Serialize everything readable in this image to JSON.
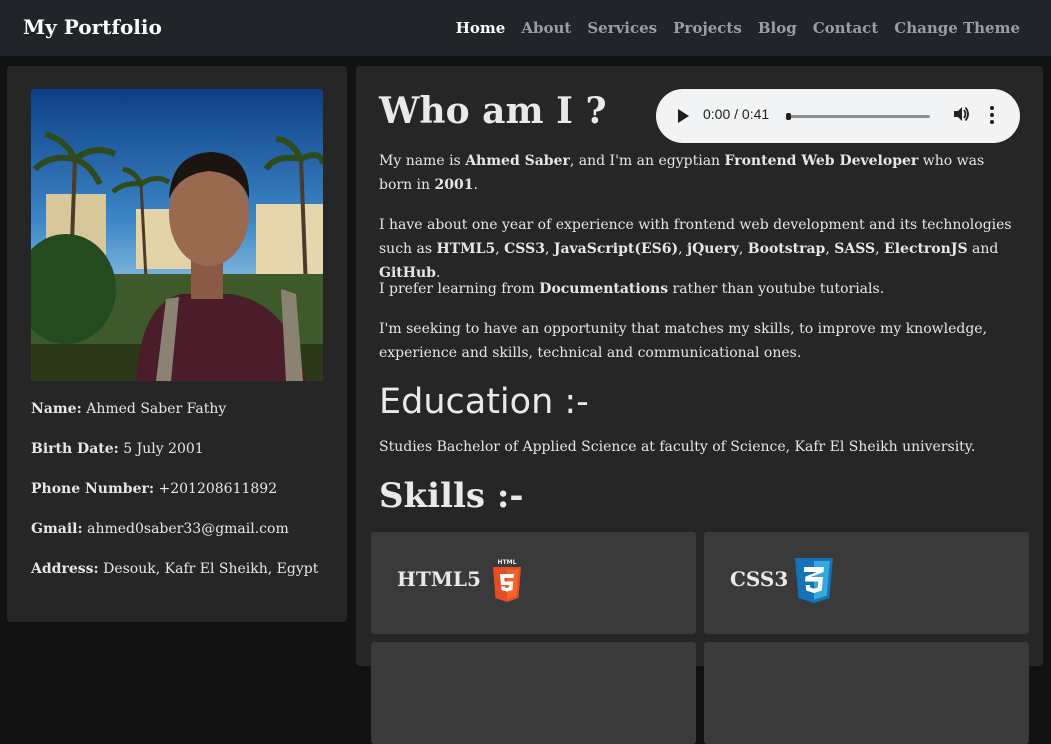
{
  "nav": {
    "brand": "My Portfolio",
    "links": [
      {
        "label": "Home",
        "active": true
      },
      {
        "label": "About",
        "active": false
      },
      {
        "label": "Services",
        "active": false
      },
      {
        "label": "Projects",
        "active": false
      },
      {
        "label": "Blog",
        "active": false
      },
      {
        "label": "Contact",
        "active": false
      },
      {
        "label": "Change Theme",
        "active": false
      }
    ]
  },
  "profile": {
    "fields": [
      {
        "label": "Name:",
        "value": "Ahmed Saber Fathy"
      },
      {
        "label": "Birth Date:",
        "value": "5 July 2001"
      },
      {
        "label": "Phone Number:",
        "value": "+201208611892"
      },
      {
        "label": "Gmail:",
        "value": "ahmed0saber33@gmail.com"
      },
      {
        "label": "Address:",
        "value": "Desouk, Kafr El Sheikh, Egypt"
      }
    ]
  },
  "about": {
    "title": "Who am I ?",
    "audio": {
      "time": "0:00 / 0:41",
      "progress": 0.0
    },
    "p1": {
      "t1": "My name is ",
      "b1": "Ahmed Saber",
      "t2": ", and I'm an egyptian ",
      "b2": "Frontend Web Developer",
      "t3": " who was born in ",
      "b3": "2001",
      "t4": "."
    },
    "p2": {
      "t1": "I have about one year of experience with frontend web development and its technologies such as ",
      "b1": "HTML5",
      "s1": ", ",
      "b2": "CSS3",
      "s2": ", ",
      "b3": "JavaScript(ES6)",
      "s3": ", ",
      "b4": "jQuery",
      "s4": ", ",
      "b5": "Bootstrap",
      "s5": ", ",
      "b6": "SASS",
      "s6": ", ",
      "b7": "ElectronJS",
      "s7": " and ",
      "b8": "GitHub",
      "s8": "."
    },
    "p3": {
      "t1": "I prefer learning from ",
      "b1": "Documentations",
      "t2": " rather than youtube tutorials."
    },
    "p4": "I'm seeking to have an opportunity that matches my skills, to improve my knowledge, experience and skills, technical and communicational ones."
  },
  "education": {
    "title": "Education :-",
    "text": "Studies Bachelor of Applied Science at faculty of Science, Kafr El Sheikh university."
  },
  "skills": {
    "title": "Skills :-",
    "items": [
      {
        "label": "HTML5",
        "icon": "html5-icon",
        "color": "#e44d26"
      },
      {
        "label": "CSS3",
        "icon": "css3-icon",
        "color": "#1572b6"
      }
    ]
  }
}
